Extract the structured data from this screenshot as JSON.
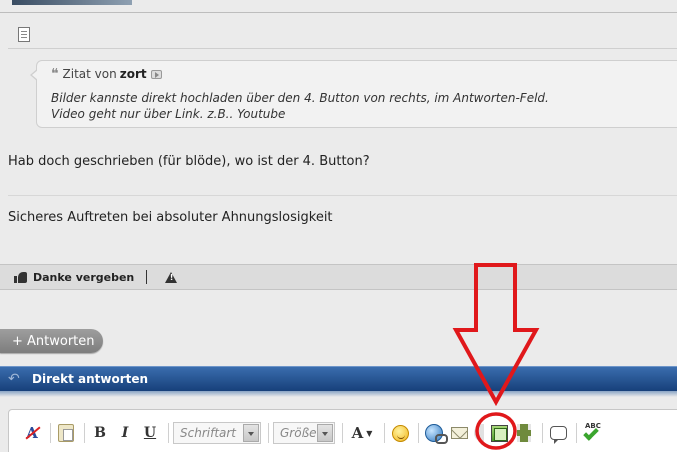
{
  "quote": {
    "prefix": "Zitat von",
    "author": "zort",
    "lines": [
      "Bilder kannste direkt hochladen über den 4. Button von rechts, im Antworten-Feld.",
      "Video geht nur über Link. z.B.. Youtube"
    ]
  },
  "post": {
    "message": "Hab doch geschrieben (für blöde), wo ist der 4. Button?",
    "signature": "Sicheres Auftreten bei absoluter Ahnungslosigkeit"
  },
  "footer": {
    "thanks_label": "Danke vergeben"
  },
  "reply_button": {
    "label": "+ Antworten"
  },
  "quick_reply": {
    "title": "Direkt antworten"
  },
  "toolbar": {
    "font_placeholder": "Schriftart",
    "size_placeholder": "Größe",
    "bold": "B",
    "italic": "I",
    "underline": "U",
    "text_color": "A",
    "remove_format": "A"
  },
  "colors": {
    "quick_reply_bar": "#1f4f8f",
    "annotation": "#e0181b",
    "page_background": "#ebebeb"
  }
}
